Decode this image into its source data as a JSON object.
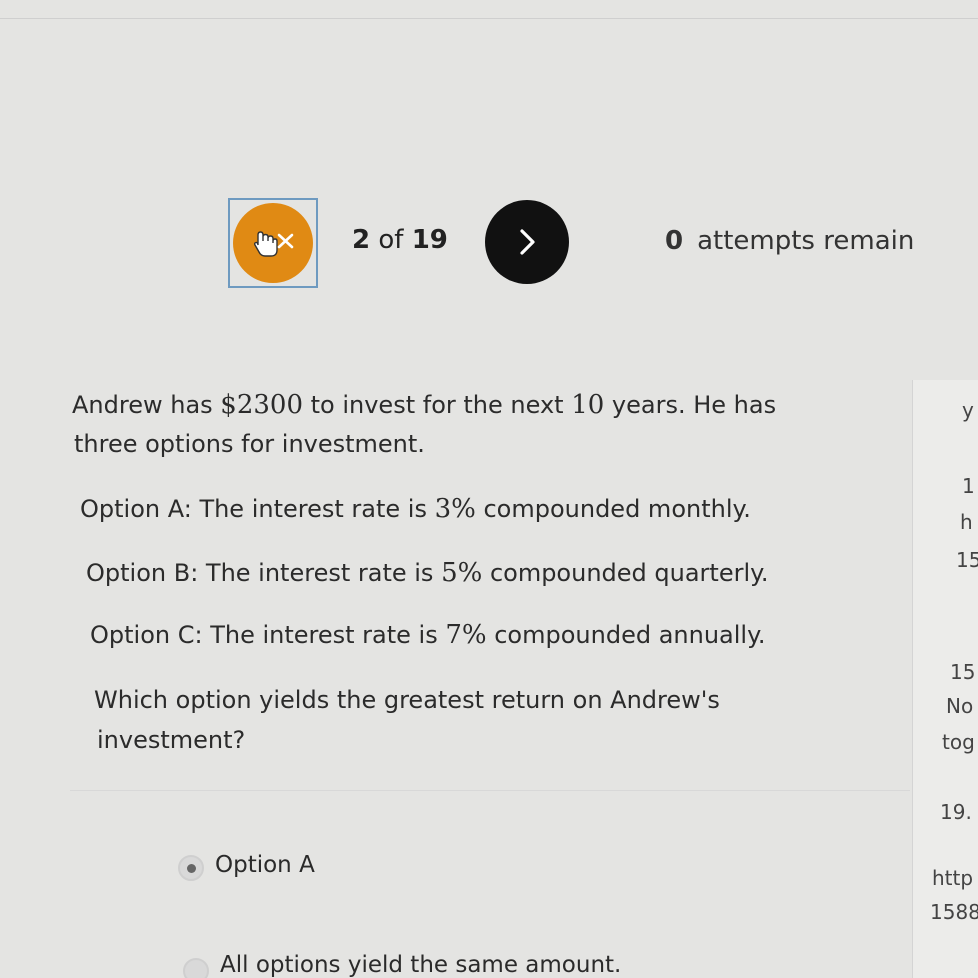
{
  "nav": {
    "current": "2",
    "of_label": "of",
    "total": "19",
    "attempts_count": "0",
    "attempts_label": "attempts remain"
  },
  "question": {
    "line1_a": "Andrew has ",
    "line1_amount": "$2300",
    "line1_b": " to invest for the next ",
    "line1_years": "10",
    "line1_c": " years. He has",
    "line2": "three options for investment.",
    "optA_a": "Option A: The interest rate is ",
    "optA_rate": "3%",
    "optA_b": " compounded monthly.",
    "optB_a": "Option B: The interest rate is ",
    "optB_rate": "5%",
    "optB_b": " compounded quarterly.",
    "optC_a": "Option C: The interest rate is ",
    "optC_rate": "7%",
    "optC_b": " compounded annually.",
    "prompt_line1": "Which option yields the greatest return on Andrew's",
    "prompt_line2": "investment?"
  },
  "answers": [
    {
      "label": "Option A",
      "selected": true
    },
    {
      "label": "All options yield the same amount.",
      "selected": false
    }
  ],
  "side_panel": [
    "y",
    "1",
    "h",
    "15",
    "15",
    "No",
    "tog",
    "19.",
    "http",
    "1588"
  ],
  "colors": {
    "back_button": "#e08a14",
    "next_button": "#111111",
    "focus_border": "#6e9ac0"
  },
  "icons": {
    "back": "pointer-hand-back-icon",
    "next": "chevron-right-icon"
  }
}
